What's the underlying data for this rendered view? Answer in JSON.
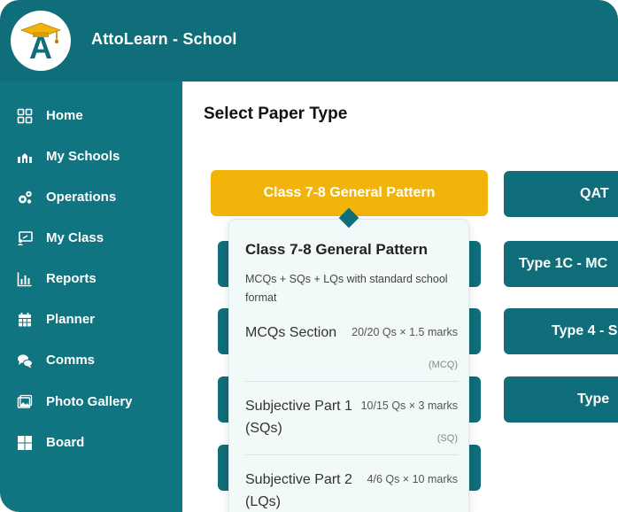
{
  "app": {
    "title": "AttoLearn - School"
  },
  "sidebar": {
    "items": [
      {
        "label": "Home",
        "icon": "grid-icon"
      },
      {
        "label": "My Schools",
        "icon": "school-icon"
      },
      {
        "label": "Operations",
        "icon": "gears-icon"
      },
      {
        "label": "My Class",
        "icon": "chalkboard-icon"
      },
      {
        "label": "Reports",
        "icon": "bar-chart-icon"
      },
      {
        "label": "Planner",
        "icon": "calendar-icon"
      },
      {
        "label": "Comms",
        "icon": "chat-icon"
      },
      {
        "label": "Photo Gallery",
        "icon": "gallery-icon"
      },
      {
        "label": "Board",
        "icon": "board-icon"
      }
    ]
  },
  "main": {
    "title": "Select Paper Type",
    "paper_types": {
      "left": [
        "Class 7-8 General Pattern",
        "",
        "",
        "",
        ""
      ],
      "right": [
        "QAT",
        "Type 1C - MC",
        "Type 4 - S",
        "Type"
      ]
    }
  },
  "tooltip": {
    "title": "Class 7-8 General Pattern",
    "description": "MCQs + SQs + LQs with standard school format",
    "sections": [
      {
        "name": "MCQs Section",
        "info": "20/20 Qs × 1.5 marks",
        "tag": "(MCQ)"
      },
      {
        "name": "Subjective Part 1 (SQs)",
        "info": "10/15 Qs × 3 marks",
        "tag": "(SQ)"
      },
      {
        "name": "Subjective Part 2 (LQs)",
        "info": "4/6 Qs × 10 marks",
        "tag": ""
      }
    ]
  },
  "colors": {
    "primary": "#0f6e7a",
    "sidebar": "#107580",
    "accent": "#f2b30b",
    "tooltip_bg": "#f1faf9"
  }
}
